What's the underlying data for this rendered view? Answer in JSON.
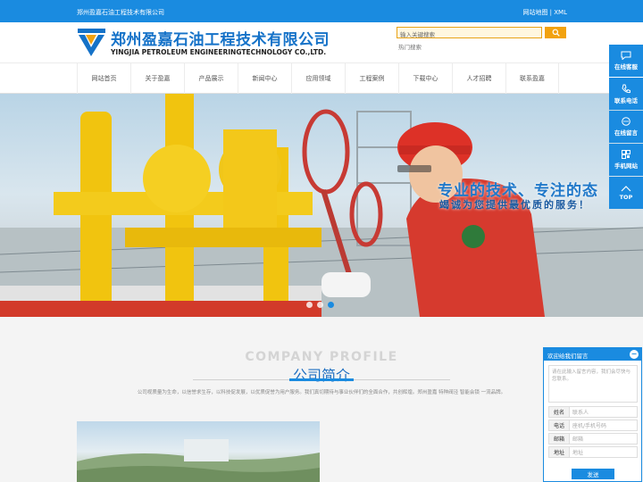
{
  "topbar": {
    "company": "郑州盈嘉石油工程技术有限公司",
    "links": "网站地图 | XML"
  },
  "header": {
    "logo_cn": "郑州盈嘉石油工程技术有限公司",
    "logo_en": "YINGJIA PETROLEUM ENGINEERINGTECHNOLOGY CO.,LTD.",
    "search_placeholder": "输入关键搜索",
    "hot_search": "热门搜索"
  },
  "nav": {
    "items": [
      "网站首页",
      "关于盈嘉",
      "产品展示",
      "新闻中心",
      "应用领域",
      "工程案例",
      "下载中心",
      "人才招聘",
      "联系盈嘉"
    ]
  },
  "banner": {
    "headline": "专业的技术、专注的态",
    "subline": "竭诚为您提供最优质的服务！",
    "slides": 3,
    "active_slide": 3
  },
  "section": {
    "title_en": "COMPANY PROFILE",
    "title_cn": "公司简介",
    "desc": "公司视质量为生命，以信誉求生存，以科技促发展，以优质促誉为用户服务。我们真切期待与事业伙伴们的全面合作，共创辉煌。郑州盈嘉 特种阀泾 智能会锁 一流品牌。"
  },
  "sidebar": {
    "items": [
      "在线客服",
      "联系电话",
      "在线留言",
      "手机网站",
      "TOP"
    ]
  },
  "message": {
    "title": "欢迎给我们留言",
    "textarea_placeholder": "请在此输入留言内容，我们会尽快与您联系。",
    "fields": [
      {
        "label": "姓名",
        "placeholder": "联系人"
      },
      {
        "label": "电话",
        "placeholder": "座机/手机号码"
      },
      {
        "label": "邮箱",
        "placeholder": "邮箱"
      },
      {
        "label": "地址",
        "placeholder": "地址"
      }
    ],
    "send": "发送"
  },
  "colors": {
    "primary": "#1a8be0",
    "accent": "#f2a20f",
    "pipe": "#f1c40f",
    "helmet": "#d9302a"
  }
}
